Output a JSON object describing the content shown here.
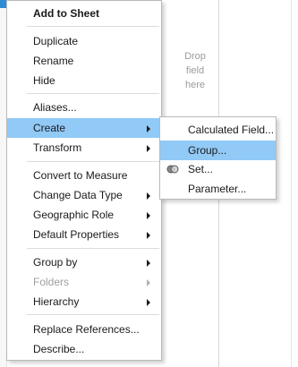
{
  "workspace": {
    "drop_hint": [
      "Drop",
      "field",
      "here"
    ]
  },
  "menu": {
    "add_to_sheet": "Add to Sheet",
    "duplicate": "Duplicate",
    "rename": "Rename",
    "hide": "Hide",
    "aliases": "Aliases...",
    "create": "Create",
    "transform": "Transform",
    "convert_to_measure": "Convert to Measure",
    "change_data_type": "Change Data Type",
    "geographic_role": "Geographic Role",
    "default_properties": "Default Properties",
    "group_by": "Group by",
    "folders": "Folders",
    "hierarchy": "Hierarchy",
    "replace_references": "Replace References...",
    "describe": "Describe..."
  },
  "submenu": {
    "calculated_field": "Calculated Field...",
    "group": "Group...",
    "set": "Set...",
    "parameter": "Parameter..."
  },
  "colors": {
    "highlight": "#91c9f7",
    "accent": "#2e8bd6"
  },
  "icons": {
    "set": "set-icon",
    "submenu_arrow": "chevron-right-icon"
  }
}
